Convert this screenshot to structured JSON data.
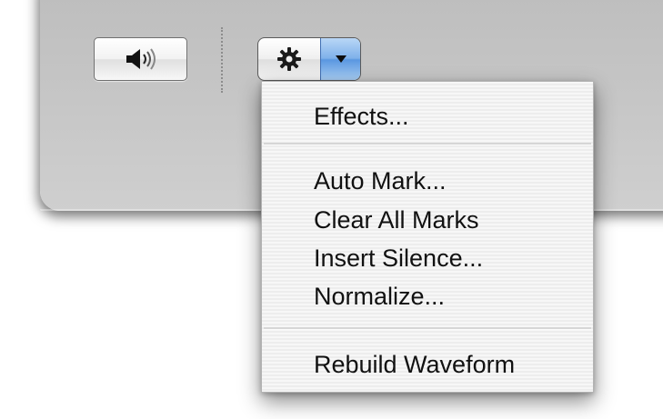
{
  "toolbar": {
    "speaker_icon": "speaker-volume-icon",
    "action_icon": "gear-icon",
    "popup_arrow_icon": "chevron-down-icon",
    "accent_color": "#5a97e0"
  },
  "menu": {
    "group1": [
      "Effects..."
    ],
    "group2": [
      "Auto Mark...",
      "Clear All Marks",
      "Insert Silence...",
      "Normalize..."
    ],
    "group3": [
      "Rebuild Waveform"
    ]
  }
}
